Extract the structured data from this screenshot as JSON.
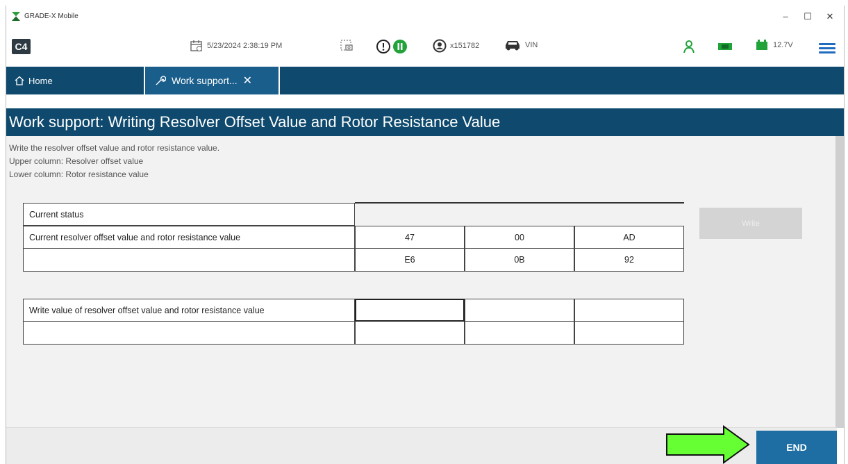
{
  "window": {
    "title": "GRADE-X Mobile",
    "minimize": "–",
    "maximize": "☐",
    "close": "✕"
  },
  "toolbar": {
    "logo": "C4",
    "datetime": "5/23/2024 2:38:19 PM",
    "user": "x151782",
    "vin": "VIN",
    "voltage": "12.7V"
  },
  "tabs": [
    {
      "label": "Home"
    },
    {
      "label": "Work support...",
      "close": "✕"
    }
  ],
  "page": {
    "title": "Work support: Writing Resolver Offset Value and Rotor Resistance Value",
    "description": [
      "Write the resolver offset value and rotor resistance value.",
      "Upper column: Resolver offset value",
      "Lower column: Rotor resistance value"
    ]
  },
  "status_table": {
    "status_label": "Current status",
    "current_label": "Current resolver offset value and rotor resistance value",
    "row1": [
      "47",
      "00",
      "AD"
    ],
    "row2": [
      "E6",
      "0B",
      "92"
    ]
  },
  "write_table": {
    "label": "Write value of resolver offset value and rotor resistance value",
    "row1": [
      "",
      "",
      ""
    ],
    "row2": [
      "",
      "",
      ""
    ]
  },
  "buttons": {
    "write": "Write",
    "end": "END"
  },
  "colors": {
    "header": "#0f4a6e",
    "active_tab": "#1a5e8c",
    "end_button": "#1e6ea3",
    "arrow": "#66ff33"
  }
}
